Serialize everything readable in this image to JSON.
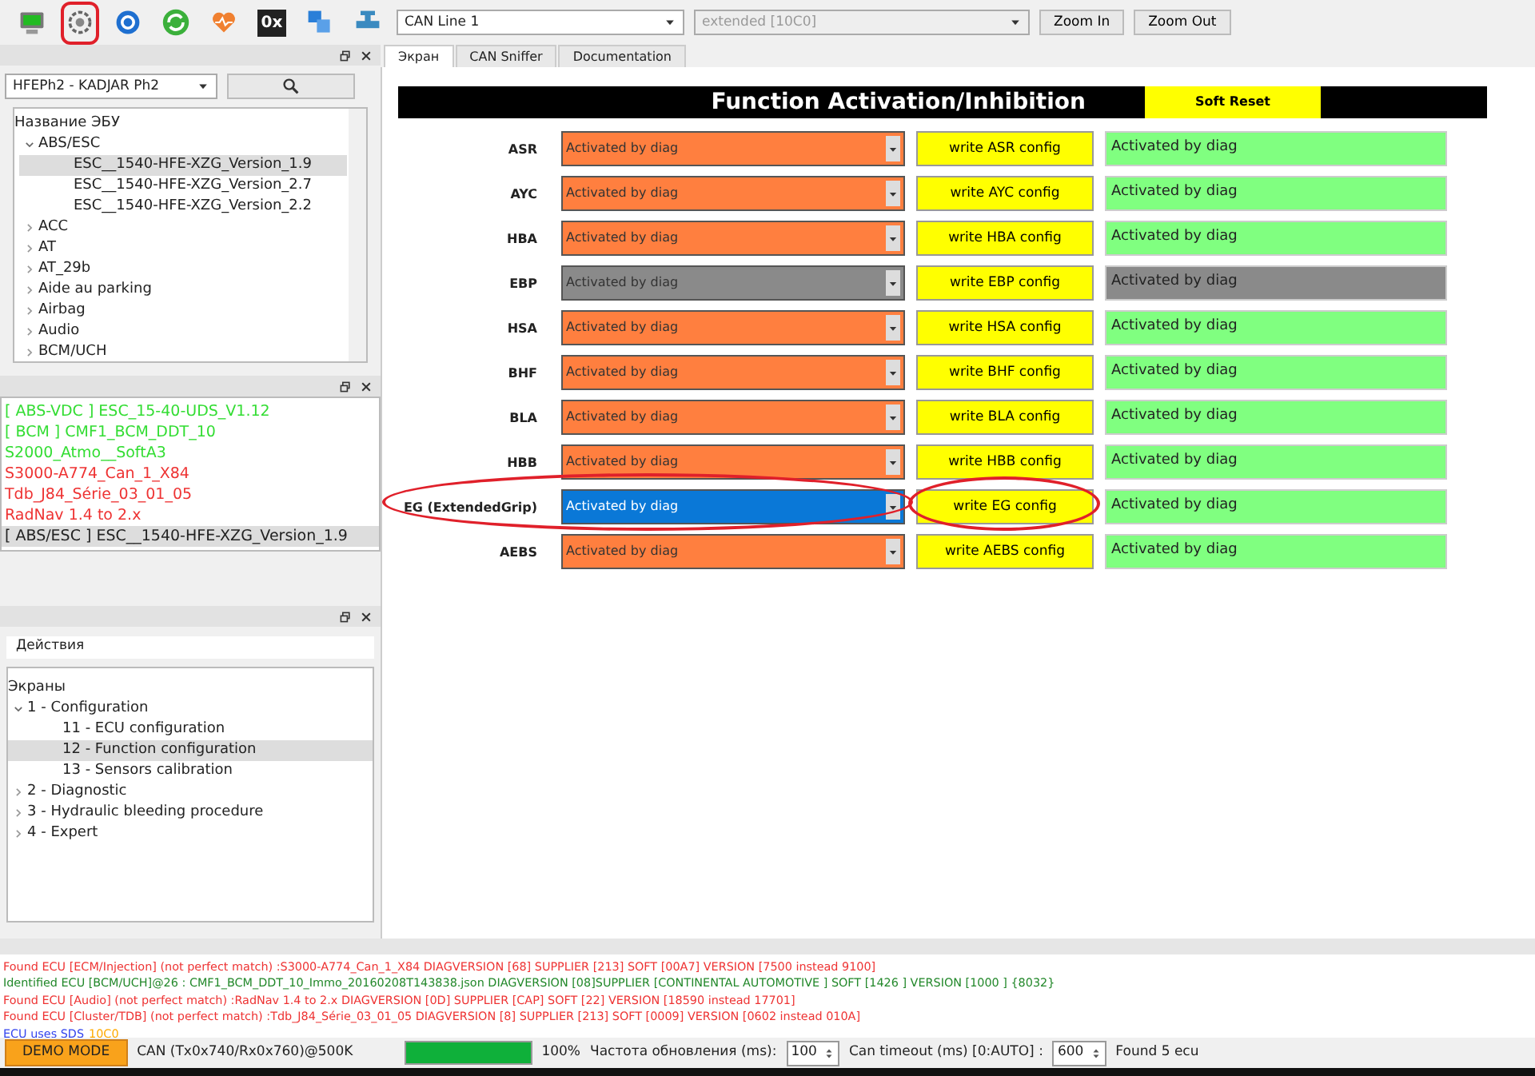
{
  "toolbar": {
    "icons": [
      {
        "kind": "monitor",
        "highlighted": false
      },
      {
        "kind": "gear",
        "highlighted": true
      },
      {
        "kind": "refresh",
        "highlighted": false
      },
      {
        "kind": "sync",
        "highlighted": false
      },
      {
        "kind": "heart",
        "highlighted": false
      },
      {
        "kind": "hex",
        "label": "0x",
        "highlighted": false
      },
      {
        "kind": "windows",
        "highlighted": false
      },
      {
        "kind": "valve",
        "highlighted": false
      }
    ],
    "can_line": "CAN Line 1",
    "can_mode": {
      "value": "extended [10C0]",
      "disabled": true
    },
    "buttons": [
      "Zoom In",
      "Zoom Out"
    ]
  },
  "ecu_panel": {
    "vehicle": "HFEPh2 - KADJAR Ph2",
    "tree_header": "Название ЭБУ",
    "tree": [
      {
        "label": "ABS/ESC",
        "expanded": true,
        "selected": false,
        "children": [
          {
            "label": "ESC__1540-HFE-XZG_Version_1.9",
            "selected": true
          },
          {
            "label": "ESC__1540-HFE-XZG_Version_2.7",
            "selected": false
          },
          {
            "label": "ESC__1540-HFE-XZG_Version_2.2",
            "selected": false
          }
        ]
      },
      {
        "label": "ACC",
        "expanded": false,
        "selected": false
      },
      {
        "label": "AT",
        "expanded": false,
        "selected": false
      },
      {
        "label": "AT_29b",
        "expanded": false,
        "selected": false
      },
      {
        "label": "Aide au parking",
        "expanded": false,
        "selected": false
      },
      {
        "label": "Airbag",
        "expanded": false,
        "selected": false
      },
      {
        "label": "Audio",
        "expanded": false,
        "selected": false
      },
      {
        "label": "BCM/UCH",
        "expanded": false,
        "selected": false
      }
    ]
  },
  "found_list": [
    {
      "label": "[ ABS-VDC ] ESC_15-40-UDS_V1.12",
      "color": "#33dd33",
      "selected": false
    },
    {
      "label": "[ BCM ] CMF1_BCM_DDT_10",
      "color": "#33dd33",
      "selected": false
    },
    {
      "label": "S2000_Atmo__SoftA3",
      "color": "#33dd33",
      "selected": false
    },
    {
      "label": "S3000-A774_Can_1_X84",
      "color": "#ee3333",
      "selected": false
    },
    {
      "label": "Tdb_J84_Série_03_01_05",
      "color": "#ee3333",
      "selected": false
    },
    {
      "label": "RadNav 1.4 to 2.x",
      "color": "#ee3333",
      "selected": false
    },
    {
      "label": "[ ABS/ESC ] ESC__1540-HFE-XZG_Version_1.9",
      "color": "#222222",
      "selected": true
    }
  ],
  "actions_panel": {
    "title": "Действия",
    "tree_header": "Экраны",
    "tree": [
      {
        "label": "1 - Configuration",
        "expanded": true,
        "selected": false,
        "children": [
          {
            "label": "11 - ECU configuration",
            "selected": false
          },
          {
            "label": "12 - Function configuration",
            "selected": true
          },
          {
            "label": "13 - Sensors calibration",
            "selected": false
          }
        ]
      },
      {
        "label": "2 - Diagnostic",
        "expanded": false,
        "selected": false
      },
      {
        "label": "3 - Hydraulic bleeding procedure",
        "expanded": false,
        "selected": false
      },
      {
        "label": "4 - Expert",
        "expanded": false,
        "selected": false
      }
    ]
  },
  "tabs": [
    {
      "label": "Экран",
      "selected": true
    },
    {
      "label": "CAN Sniffer",
      "selected": false
    },
    {
      "label": "Documentation",
      "selected": false
    }
  ],
  "screen": {
    "title": "Function Activation/Inhibition",
    "reset_button": "Soft Reset",
    "rows": [
      {
        "name": "ASR",
        "value": "Activated by diag",
        "button": "write ASR config",
        "status": "Activated by diag",
        "disabled": false,
        "focused": false,
        "highlighted": false
      },
      {
        "name": "AYC",
        "value": "Activated by diag",
        "button": "write AYC config",
        "status": "Activated by diag",
        "disabled": false,
        "focused": false,
        "highlighted": false
      },
      {
        "name": "HBA",
        "value": "Activated by diag",
        "button": "write HBA config",
        "status": "Activated by diag",
        "disabled": false,
        "focused": false,
        "highlighted": false
      },
      {
        "name": "EBP",
        "value": "Activated by diag",
        "button": "write EBP config",
        "status": "Activated by diag",
        "disabled": true,
        "focused": false,
        "highlighted": false
      },
      {
        "name": "HSA",
        "value": "Activated by diag",
        "button": "write HSA config",
        "status": "Activated by diag",
        "disabled": false,
        "focused": false,
        "highlighted": false
      },
      {
        "name": "BHF",
        "value": "Activated by diag",
        "button": "write BHF config",
        "status": "Activated by diag",
        "disabled": false,
        "focused": false,
        "highlighted": false
      },
      {
        "name": "BLA",
        "value": "Activated by diag",
        "button": "write BLA config",
        "status": "Activated by diag",
        "disabled": false,
        "focused": false,
        "highlighted": false
      },
      {
        "name": "HBB",
        "value": "Activated by diag",
        "button": "write HBB config",
        "status": "Activated by diag",
        "disabled": false,
        "focused": false,
        "highlighted": false
      },
      {
        "name": "EG (ExtendedGrip)",
        "value": "Activated by diag",
        "button": "write EG config",
        "status": "Activated by diag",
        "disabled": false,
        "focused": true,
        "highlighted": true
      },
      {
        "name": "AEBS",
        "value": "Activated by diag",
        "button": "write AEBS config",
        "status": "Activated by diag",
        "disabled": false,
        "focused": false,
        "highlighted": false
      }
    ]
  },
  "log": [
    {
      "parts": [
        {
          "text": "Found ECU [ECM/Injection] (not perfect match) :S3000-A774_Can_1_X84 DIAGVERSION [68] SUPPLIER [213] SOFT [00A7] VERSION [7500 instead 9100]",
          "color": "#ee3333"
        }
      ]
    },
    {
      "parts": [
        {
          "text": "Identified ECU [BCM/UCH]@26 : CMF1_BCM_DDT_10_Immo_20160208T143838.json DIAGVERSION [08]SUPPLIER [CONTINENTAL AUTOMOTIVE ] SOFT [1426 ] VERSION [1000 ] {8032}",
          "color": "#22882a"
        }
      ]
    },
    {
      "parts": [
        {
          "text": "Found ECU [Audio] (not perfect match) :RadNav 1.4 to 2.x DIAGVERSION [0D] SUPPLIER [CAP] SOFT [22] VERSION [18590 instead 17701]",
          "color": "#ee3333"
        }
      ]
    },
    {
      "parts": [
        {
          "text": "Found ECU [Cluster/TDB] (not perfect match) :Tdb_J84_Série_03_01_05 DIAGVERSION [8] SUPPLIER [213] SOFT [0009] VERSION [0602 instead 010A]",
          "color": "#ee3333"
        }
      ]
    },
    {
      "parts": [
        {
          "text": "ECU uses SDS",
          "color": "#3344ee"
        },
        {
          "text": "10C0",
          "color": "#ffaa00"
        }
      ]
    }
  ],
  "status_bar": {
    "mode": "DEMO MODE",
    "can": "CAN (Tx0x740/Rx0x760)@500K",
    "progress": {
      "level": 1.0,
      "reading": "100%"
    },
    "refresh_label": "Частота обновления (ms):",
    "refresh_value": "100",
    "timeout_label": "Can timeout (ms) [0:AUTO] :",
    "timeout_value": "600",
    "found": "Found 5 ecu"
  }
}
